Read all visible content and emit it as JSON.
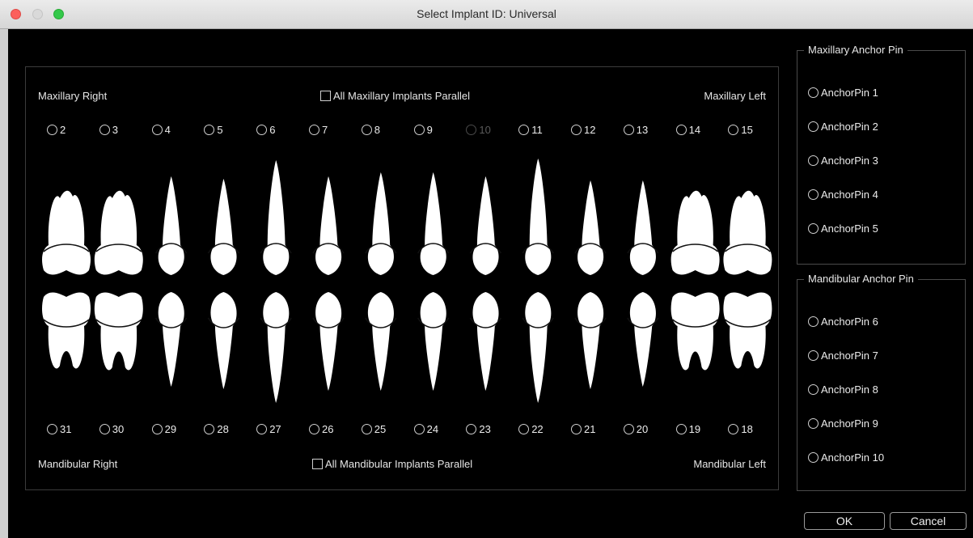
{
  "window": {
    "title": "Select Implant ID: Universal"
  },
  "teeth_panel": {
    "maxillary_right": "Maxillary Right",
    "maxillary_left": "Maxillary Left",
    "mandibular_right": "Mandibular Right",
    "mandibular_left": "Mandibular Left",
    "all_maxillary_parallel": "All Maxillary Implants Parallel",
    "all_mandibular_parallel": "All Mandibular Implants Parallel",
    "upper_teeth": [
      {
        "label": "2",
        "enabled": true
      },
      {
        "label": "3",
        "enabled": true
      },
      {
        "label": "4",
        "enabled": true
      },
      {
        "label": "5",
        "enabled": true
      },
      {
        "label": "6",
        "enabled": true
      },
      {
        "label": "7",
        "enabled": true
      },
      {
        "label": "8",
        "enabled": true
      },
      {
        "label": "9",
        "enabled": true
      },
      {
        "label": "10",
        "enabled": false
      },
      {
        "label": "11",
        "enabled": true
      },
      {
        "label": "12",
        "enabled": true
      },
      {
        "label": "13",
        "enabled": true
      },
      {
        "label": "14",
        "enabled": true
      },
      {
        "label": "15",
        "enabled": true
      }
    ],
    "lower_teeth": [
      {
        "label": "31",
        "enabled": true
      },
      {
        "label": "30",
        "enabled": true
      },
      {
        "label": "29",
        "enabled": true
      },
      {
        "label": "28",
        "enabled": true
      },
      {
        "label": "27",
        "enabled": true
      },
      {
        "label": "26",
        "enabled": true
      },
      {
        "label": "25",
        "enabled": true
      },
      {
        "label": "24",
        "enabled": true
      },
      {
        "label": "23",
        "enabled": true
      },
      {
        "label": "22",
        "enabled": true
      },
      {
        "label": "21",
        "enabled": true
      },
      {
        "label": "20",
        "enabled": true
      },
      {
        "label": "19",
        "enabled": true
      },
      {
        "label": "18",
        "enabled": true
      }
    ]
  },
  "maxillary_anchor": {
    "title": "Maxillary Anchor Pin",
    "pins": [
      "AnchorPin 1",
      "AnchorPin 2",
      "AnchorPin 3",
      "AnchorPin 4",
      "AnchorPin 5"
    ]
  },
  "mandibular_anchor": {
    "title": "Mandibular Anchor Pin",
    "pins": [
      "AnchorPin 6",
      "AnchorPin 7",
      "AnchorPin 8",
      "AnchorPin 9",
      "AnchorPin 10"
    ]
  },
  "buttons": {
    "ok": "OK",
    "cancel": "Cancel"
  },
  "colors": {
    "background": "#000000",
    "text": "#e6e6e6",
    "tooth": "#ffffff",
    "disabled": "#5a5a5a"
  }
}
